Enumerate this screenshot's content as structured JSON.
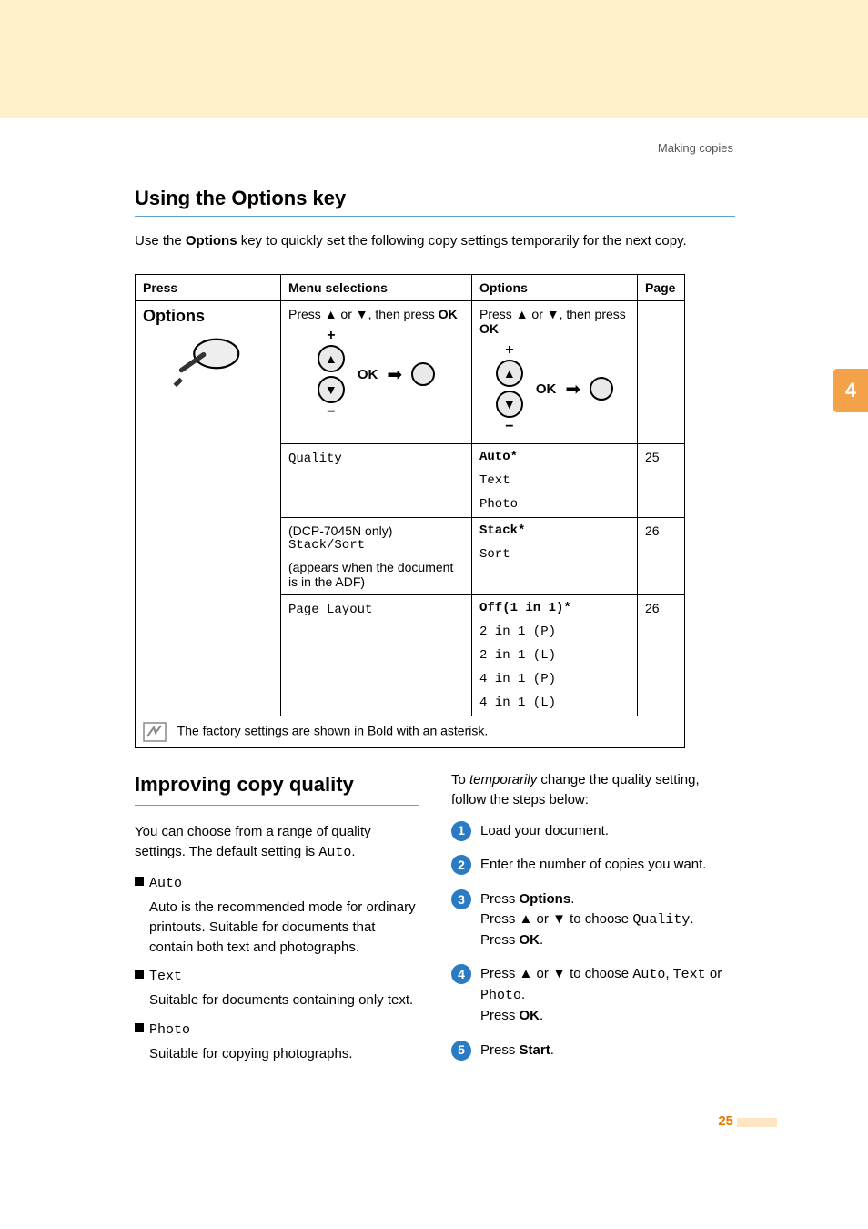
{
  "header": {
    "breadcrumb": "Making copies"
  },
  "sidetab": {
    "chapter": "4"
  },
  "section1": {
    "title": "Using the Options key",
    "intro_pre": "Use the ",
    "intro_bold": "Options",
    "intro_post": " key to quickly set the following copy settings temporarily for the next copy."
  },
  "table": {
    "headers": {
      "press": "Press",
      "menu": "Menu selections",
      "options": "Options",
      "page": "Page"
    },
    "row_top": {
      "press_label": "Options",
      "menu_hint_pre": "Press ",
      "menu_hint_a": "a",
      "menu_hint_mid": " or ",
      "menu_hint_b": "b",
      "menu_hint_post": ", then press ",
      "menu_hint_ok": "OK",
      "ok_label": "OK"
    },
    "row_quality": {
      "menu": "Quality",
      "opt1": "Auto*",
      "opt2": "Text",
      "opt3": "Photo",
      "page": "25"
    },
    "row_stack": {
      "menu_note": "(DCP-7045N only)",
      "menu": "Stack/Sort",
      "menu_sub": "(appears when the document is in the ADF)",
      "opt1": "Stack*",
      "opt2": "Sort",
      "page": "26"
    },
    "row_layout": {
      "menu": "Page Layout",
      "opt1": "Off(1 in 1)*",
      "opt2": "2 in 1 (P)",
      "opt3": "2 in 1 (L)",
      "opt4": "4 in 1 (P)",
      "opt5": "4 in 1 (L)",
      "page": "26"
    },
    "footnote": "The factory settings are shown in Bold with an asterisk."
  },
  "section2": {
    "title": "Improving copy quality",
    "left": {
      "p1_pre": "You can choose from a range of quality settings. The default setting is ",
      "p1_mono": "Auto",
      "p1_post": ".",
      "items": [
        {
          "name": "Auto",
          "desc": "Auto is the recommended mode for ordinary printouts. Suitable for documents that contain both text and photographs."
        },
        {
          "name": "Text",
          "desc": "Suitable for documents containing only text."
        },
        {
          "name": "Photo",
          "desc": "Suitable for copying photographs."
        }
      ]
    },
    "right": {
      "lead_pre": "To ",
      "lead_it": "temporarily",
      "lead_post": " change the quality setting, follow the steps below:",
      "steps": {
        "s1": "Load your document.",
        "s2": "Enter the number of copies you want.",
        "s3_a": "Press ",
        "s3_b": "Options",
        "s3_c": ".",
        "s3_d": "Press ",
        "s3_e": "a",
        "s3_f": " or ",
        "s3_g": "b",
        "s3_h": " to choose ",
        "s3_i": "Quality",
        "s3_j": ".",
        "s3_k": "Press ",
        "s3_l": "OK",
        "s3_m": ".",
        "s4_a": "Press ",
        "s4_b": "a",
        "s4_c": " or ",
        "s4_d": "b",
        "s4_e": " to choose ",
        "s4_f": "Auto",
        "s4_g": ", ",
        "s4_h": "Text",
        "s4_i": " or ",
        "s4_j": "Photo",
        "s4_k": ".",
        "s4_l": "Press ",
        "s4_m": "OK",
        "s4_n": ".",
        "s5_a": "Press ",
        "s5_b": "Start",
        "s5_c": "."
      }
    }
  },
  "footer": {
    "page": "25"
  }
}
